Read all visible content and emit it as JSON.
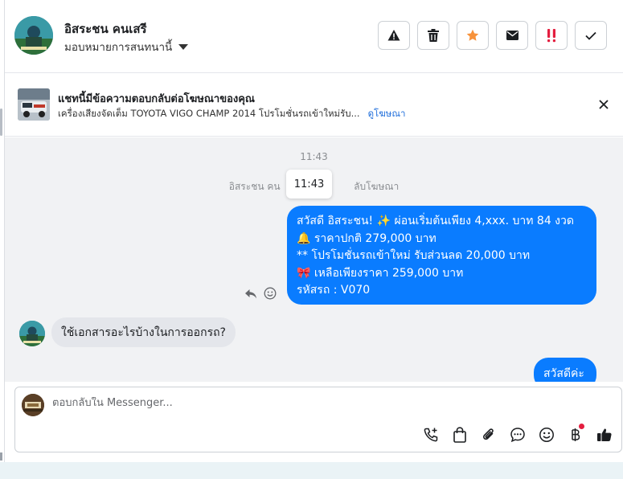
{
  "header": {
    "contact_name": "อิสระชน คนเสรี",
    "assign_label": "มอบหมายการสนทนานี้",
    "action_icons": [
      "warning-icon",
      "trash-icon",
      "star-icon",
      "envelope-icon",
      "double-exclamation-icon",
      "check-icon"
    ],
    "colors": {
      "star": "#f7923b",
      "alert": "#e41e3f"
    }
  },
  "ad_banner": {
    "title": "แชทนี้มีข้อความตอบกลับต่อโฆษณาของคุณ",
    "description": "เครื่องเสียงจัดเต็ม TOYOTA VIGO CHAMP 2014 โปรโมชั่นรถเข้าใหม่รับ...",
    "link": "ดูโฆษณา"
  },
  "conversation": {
    "time": "11:43",
    "system_text": "อิสระชน คน                        ลับโฆษณา",
    "tooltip_time": "11:43",
    "outgoing_lines": [
      "สวัสดี อิสระชน! ✨  ผ่อนเริ่มต้นเพียง 4,xxx. บาท 84 งวด",
      "🔔 ราคาปกติ 279,000 บาท",
      "** โปรโมชั่นรถเข้าใหม่ รับส่วนลด 20,000 บาท",
      "🎀  เหลือเพียงราคา 259,000 บาท",
      " รหัสรถ : V070"
    ],
    "incoming": "ใช้เอกสารอะไรบ้างในการออกรถ?",
    "outgoing_partial": "สวัสดีค่ะ",
    "colors": {
      "outgoing_bubble": "#0a7cff",
      "incoming_bubble": "#e4e6eb"
    }
  },
  "composer": {
    "placeholder": "ตอบกลับใน Messenger...",
    "tool_icons": [
      "call-add-icon",
      "shopping-bag-icon",
      "paperclip-icon",
      "chat-bubble-icon",
      "emoji-icon",
      "baht-icon",
      "thumbs-up-icon"
    ]
  }
}
